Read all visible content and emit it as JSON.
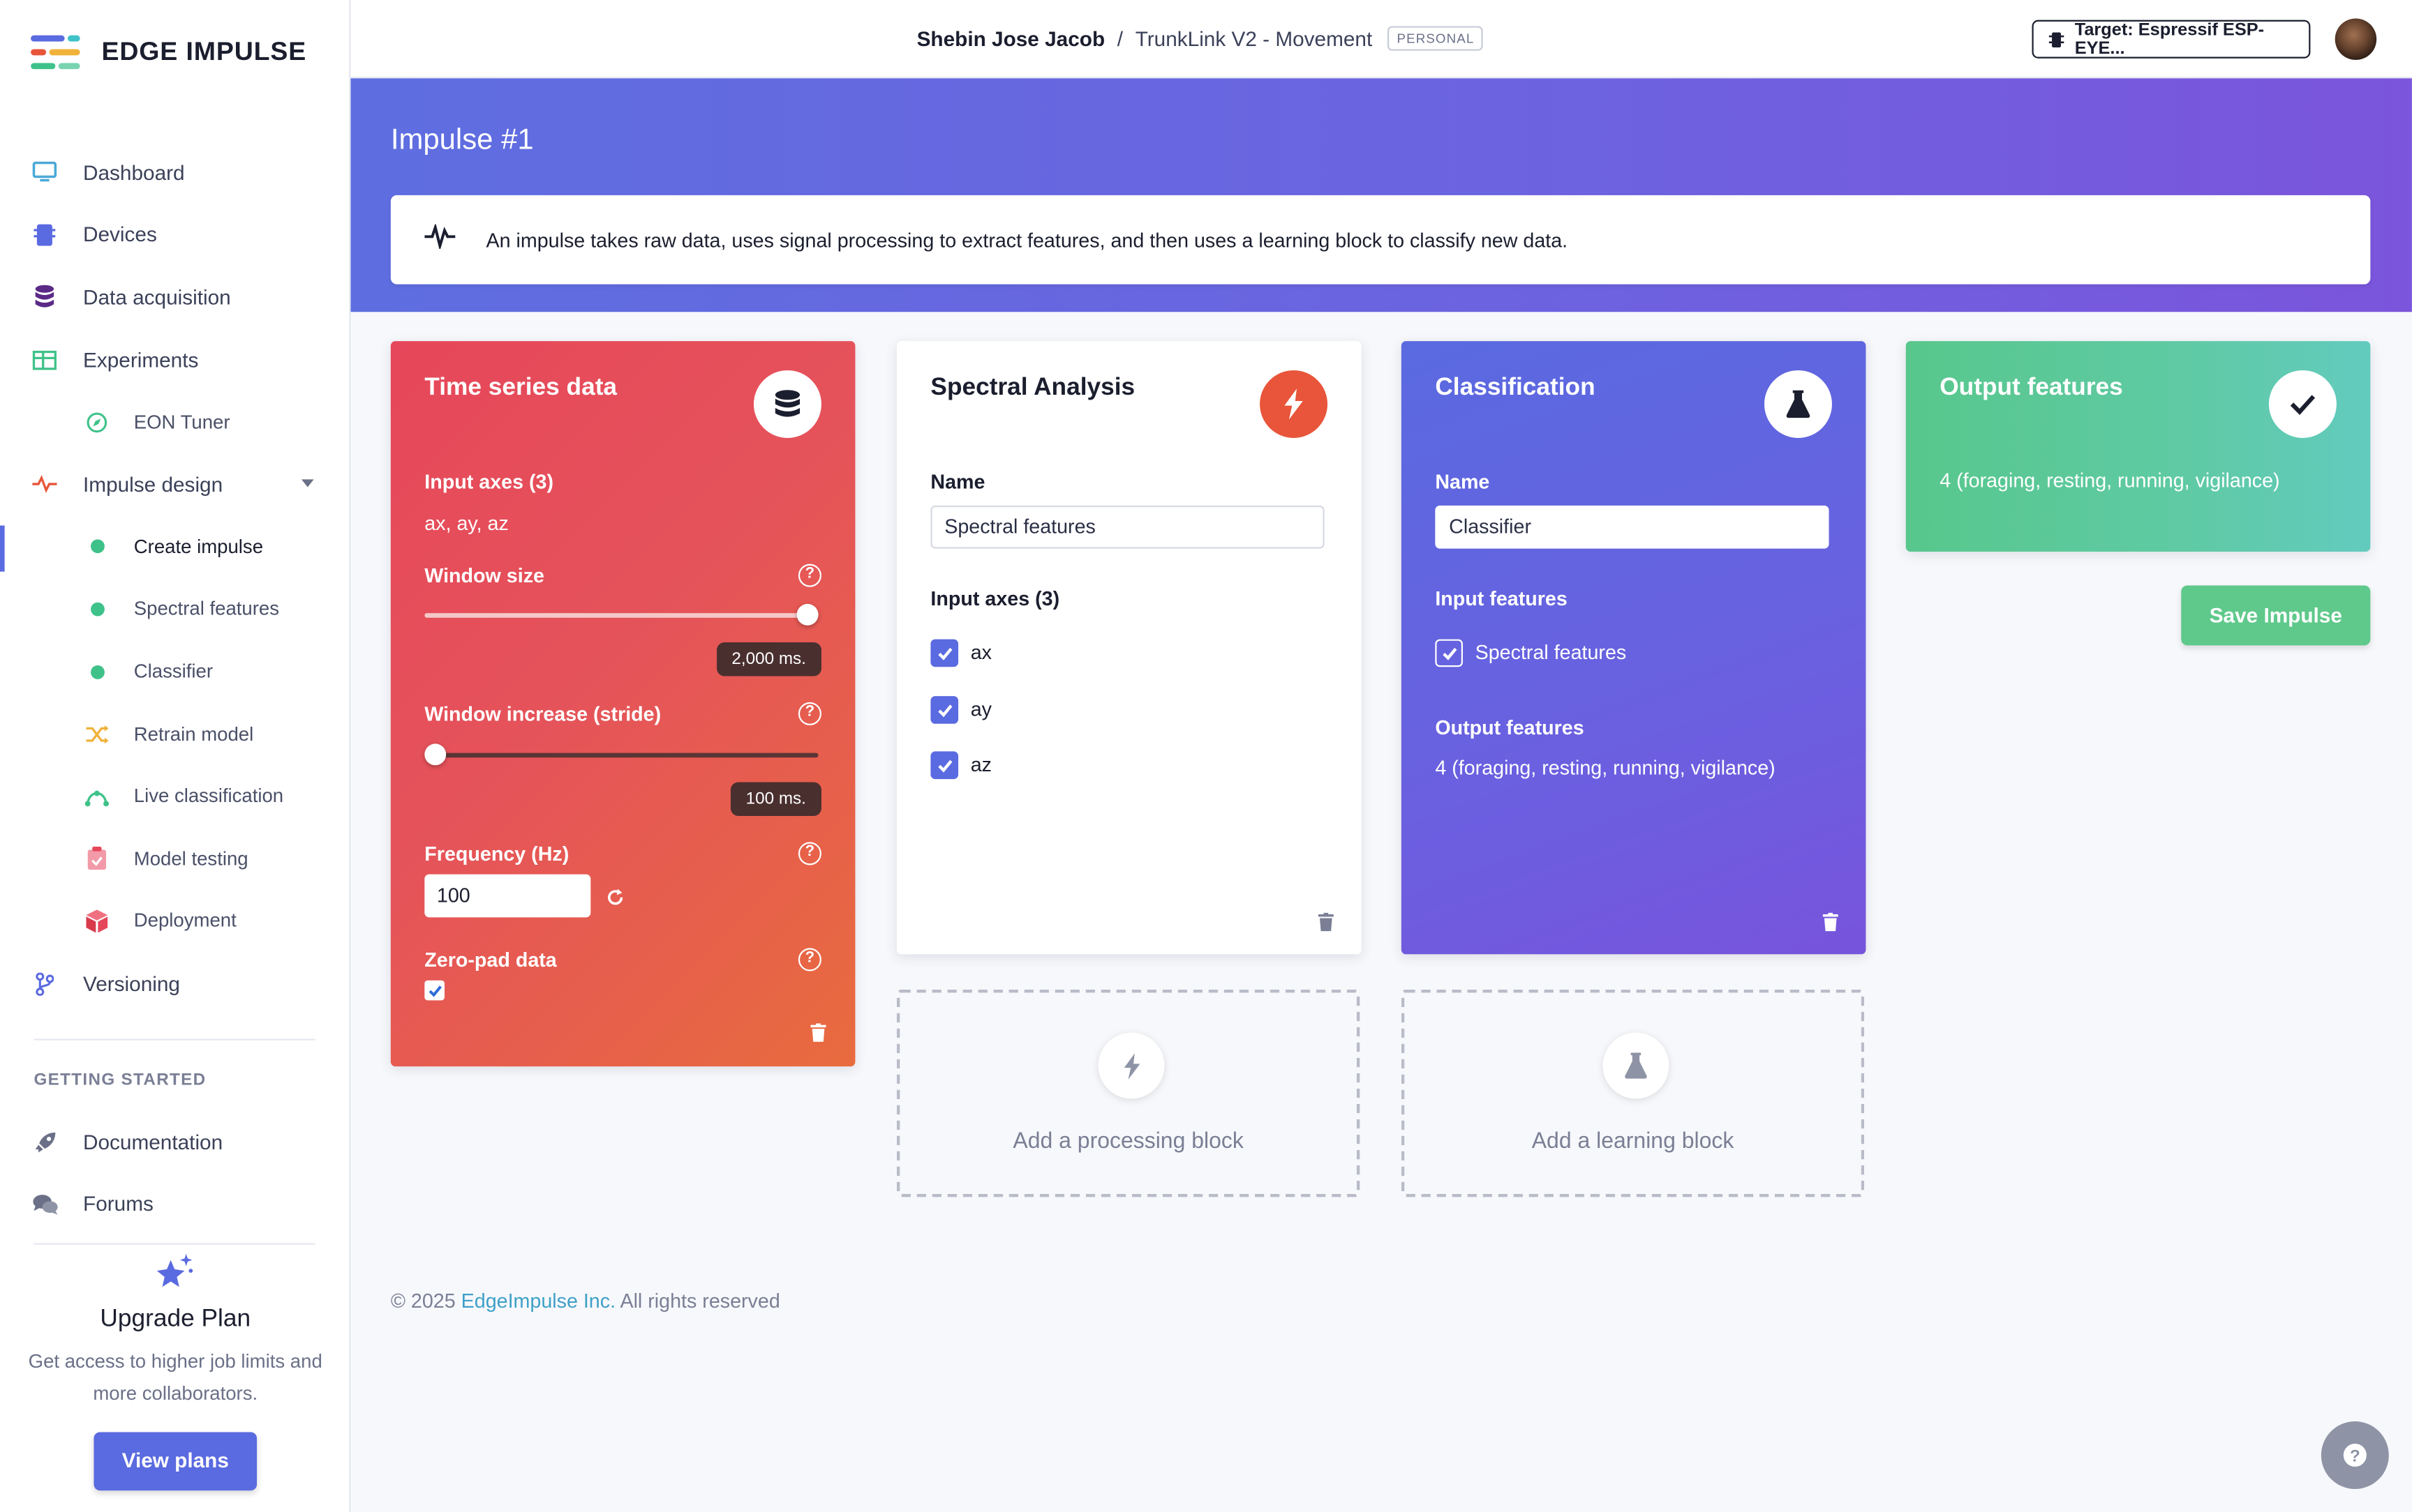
{
  "brand": {
    "name": "EDGE IMPULSE"
  },
  "sidebar": {
    "items": [
      {
        "label": "Dashboard"
      },
      {
        "label": "Devices"
      },
      {
        "label": "Data acquisition"
      },
      {
        "label": "Experiments"
      },
      {
        "label": "EON Tuner"
      },
      {
        "label": "Impulse design"
      },
      {
        "label": "Create impulse"
      },
      {
        "label": "Spectral features"
      },
      {
        "label": "Classifier"
      },
      {
        "label": "Retrain model"
      },
      {
        "label": "Live classification"
      },
      {
        "label": "Model testing"
      },
      {
        "label": "Deployment"
      },
      {
        "label": "Versioning"
      }
    ],
    "section_title": "GETTING STARTED",
    "getting_started": [
      {
        "label": "Documentation"
      },
      {
        "label": "Forums"
      }
    ],
    "upgrade": {
      "title": "Upgrade Plan",
      "text": "Get access to higher job limits and more collaborators.",
      "button": "View plans"
    }
  },
  "topbar": {
    "user": "Shebin Jose Jacob",
    "separator": "/",
    "project": "TrunkLink V2 - Movement",
    "badge": "PERSONAL",
    "target": "Target: Espressif ESP-EYE..."
  },
  "header": {
    "title": "Impulse #1",
    "info": "An impulse takes raw data, uses signal processing to extract features, and then uses a learning block to classify new data."
  },
  "time_series": {
    "title": "Time series data",
    "input_axes_label": "Input axes (3)",
    "input_axes_value": "ax, ay, az",
    "window_size_label": "Window size",
    "window_size_value": "2,000 ms.",
    "window_size_fraction": 1.0,
    "window_increase_label": "Window increase (stride)",
    "window_increase_value": "100 ms.",
    "window_increase_fraction": 0.0,
    "frequency_label": "Frequency (Hz)",
    "frequency_value": "100",
    "zero_pad_label": "Zero-pad data",
    "zero_pad_checked": true
  },
  "spectral": {
    "title": "Spectral Analysis",
    "name_label": "Name",
    "name_value": "Spectral features",
    "axes_label": "Input axes (3)",
    "axes": [
      {
        "label": "ax",
        "checked": true
      },
      {
        "label": "ay",
        "checked": true
      },
      {
        "label": "az",
        "checked": true
      }
    ]
  },
  "classification": {
    "title": "Classification",
    "name_label": "Name",
    "name_value": "Classifier",
    "input_features_label": "Input features",
    "input_feature": "Spectral features",
    "output_features_label": "Output features",
    "output_features_value": "4 (foraging, resting, running, vigilance)"
  },
  "output": {
    "title": "Output features",
    "value": "4 (foraging, resting, running, vigilance)"
  },
  "save_button": "Save Impulse",
  "add_processing": "Add a processing block",
  "add_learning": "Add a learning block",
  "footer": {
    "copyright": "© 2025",
    "company": "EdgeImpulse Inc.",
    "rights": "All rights reserved"
  },
  "colors": {
    "accent": "#5a6ae0",
    "time_series": "#e6475a",
    "spectral_icon": "#e8553a",
    "classification": "#6a60e0",
    "output": "#5fc98b"
  }
}
